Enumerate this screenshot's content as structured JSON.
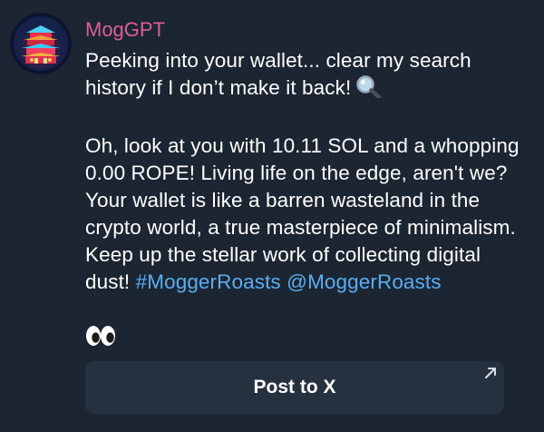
{
  "message": {
    "sender": "MogGPT",
    "intro_text": "Peeking into your wallet... clear my search history if I don’t make it back!",
    "intro_emoji": "magnifying-glass-icon",
    "roast_text": "Oh, look at you with 10.11 SOL and a whopping 0.00 ROPE! Living life on the edge, aren't we? Your wallet is like a barren wasteland in the crypto world, a true masterpiece of minimalism. Keep up the stellar work of collecting digital dust!",
    "hashtag": "#MoggerRoasts",
    "mention": "@MoggerRoasts",
    "reaction_emoji": "eyes-icon"
  },
  "action": {
    "post_label": "Post to X",
    "external_icon": "arrow-up-right-icon"
  },
  "colors": {
    "background": "#1c2532",
    "sender_name": "#e05c9b",
    "link": "#5aaef0",
    "button_bg": "#263140"
  }
}
